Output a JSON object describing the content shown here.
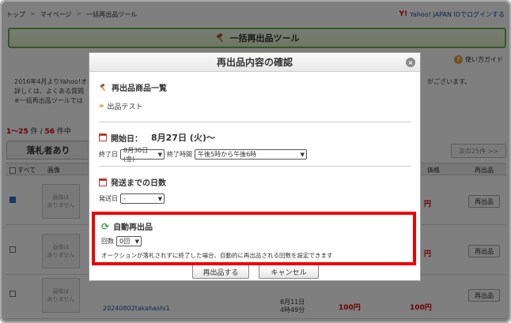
{
  "breadcrumb": [
    "トップ",
    "マイページ",
    "一括再出品ツール"
  ],
  "login": {
    "logo": "Y!",
    "label": "Yahoo! JAPAN IDでログインする"
  },
  "banner": {
    "title": "一括再出品ツール",
    "icon": "hammer-icon"
  },
  "usage_guide": "使い方ガイド",
  "notice_lines": [
    "2016年4月よりYahoo!オ",
    "詳しくは、よくある質問",
    "※一括再出品ツールでは"
  ],
  "notice_right": "がございます。",
  "count": {
    "range": "1〜25",
    "unit1": "件",
    "slash": "/",
    "total": "56",
    "unit2": "件中"
  },
  "tab_won": "落札者あり",
  "next_button": "次の25件 >>",
  "table_header": {
    "all": "すべて",
    "image": "画像",
    "price": "価格",
    "relist": "再出品"
  },
  "rows": [
    {
      "checked": true,
      "no_image": "画像は\nありません",
      "price": "円",
      "relist": "再出品"
    },
    {
      "checked": false,
      "no_image": "画像は\nありません",
      "price": "円",
      "relist": "再出品"
    },
    {
      "checked": false,
      "no_image": "画像は\nありません",
      "seller": "20240802takahashi1",
      "end": "8月11日\n4時49分",
      "price_a": "100円",
      "price_b": "100円",
      "relist": "再出品"
    }
  ],
  "modal": {
    "title": "再出品内容の確認",
    "close": "×",
    "item_list_title": "再出品商品一覧",
    "item_name": "出品テスト",
    "start_title": "開始日：",
    "start_date": "8月27日 (火)〜",
    "end_day_label": "終了日",
    "end_day_value": "8月30日 (金)",
    "end_time_label": "終了時間",
    "end_time_value": "午後5時から午後6時",
    "ship_title": "発送までの日数",
    "ship_label": "発送日",
    "ship_value": "-",
    "auto_title": "自動再出品",
    "auto_count_label": "回数",
    "auto_count_value": "0回",
    "auto_note": "オークションが落札されずに終了した場合、自動的に再出品される回数を設定できます",
    "submit": "再出品する",
    "cancel": "キャンセル"
  },
  "colors": {
    "highlight": "#e00000",
    "accent_green": "#6ab04c",
    "price_red": "#dd0000"
  }
}
